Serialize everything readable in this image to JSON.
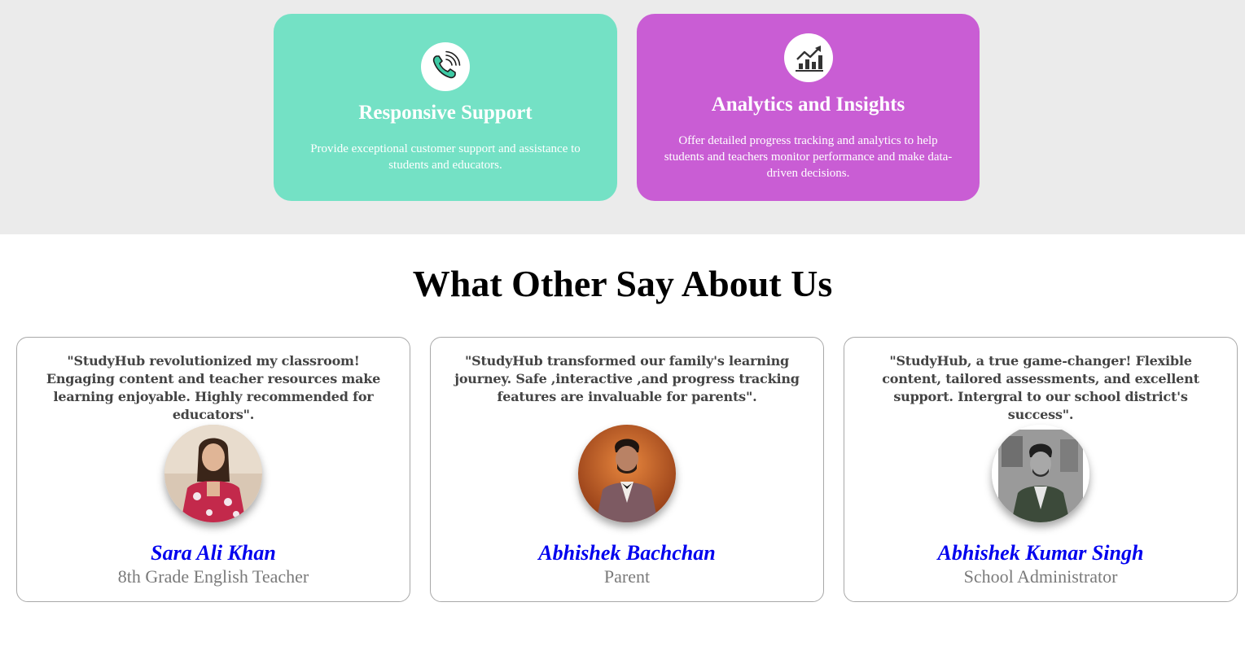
{
  "features": [
    {
      "icon": "phone-ringing-icon",
      "title": "Responsive Support",
      "description": "Provide exceptional customer support and assistance to students and educators.",
      "color": "#74e1c5"
    },
    {
      "icon": "growth-chart-icon",
      "title": "Analytics and Insights",
      "description": "Offer detailed progress tracking and analytics to help students and teachers monitor performance and make data-driven decisions.",
      "color": "#c95dd4"
    }
  ],
  "testimonials_section": {
    "title": "What Other Say About Us",
    "items": [
      {
        "quote": "\"StudyHub revolutionized my classroom! Engaging content and teacher resources make learning enjoyable. Highly recommended for educators\".",
        "name": "Sara Ali Khan",
        "role": "8th Grade English Teacher"
      },
      {
        "quote": "\"StudyHub transformed our family's learning journey. Safe ,interactive ,and progress tracking features are invaluable for parents\".",
        "name": "Abhishek Bachchan",
        "role": "Parent"
      },
      {
        "quote": "\"StudyHub, a true game-changer! Flexible content, tailored assessments, and excellent support. Intergral to our school district's success\".",
        "name": "Abhishek Kumar Singh",
        "role": "School Administrator"
      }
    ]
  },
  "colors": {
    "band_background": "#ebebeb",
    "name_color": "#0000ee",
    "role_color": "#7a7a7a"
  }
}
